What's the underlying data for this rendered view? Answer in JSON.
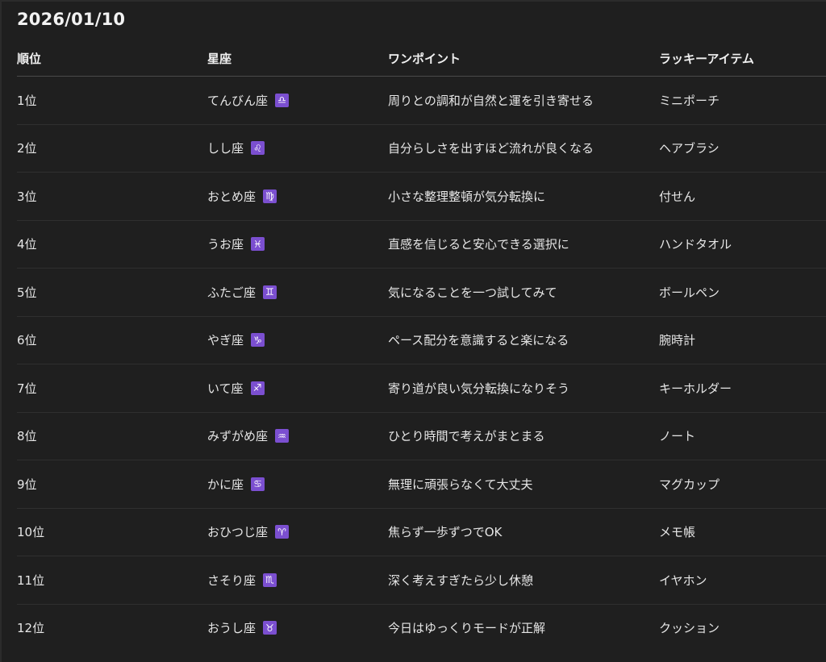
{
  "date": "2026/01/10",
  "table": {
    "headers": {
      "rank": "順位",
      "sign": "星座",
      "tip": "ワンポイント",
      "lucky_item": "ラッキーアイテム"
    },
    "accent_color": "#7b4fd0",
    "rows": [
      {
        "rank": "1位",
        "sign": "てんびん座",
        "symbol": "♎",
        "icon": "libra-icon",
        "tip": "周りとの調和が自然と運を引き寄せる",
        "item": "ミニポーチ"
      },
      {
        "rank": "2位",
        "sign": "しし座",
        "symbol": "♌",
        "icon": "leo-icon",
        "tip": "自分らしさを出すほど流れが良くなる",
        "item": "ヘアブラシ"
      },
      {
        "rank": "3位",
        "sign": "おとめ座",
        "symbol": "♍",
        "icon": "virgo-icon",
        "tip": "小さな整理整頓が気分転換に",
        "item": "付せん"
      },
      {
        "rank": "4位",
        "sign": "うお座",
        "symbol": "♓",
        "icon": "pisces-icon",
        "tip": "直感を信じると安心できる選択に",
        "item": "ハンドタオル"
      },
      {
        "rank": "5位",
        "sign": "ふたご座",
        "symbol": "♊",
        "icon": "gemini-icon",
        "tip": "気になることを一つ試してみて",
        "item": "ボールペン"
      },
      {
        "rank": "6位",
        "sign": "やぎ座",
        "symbol": "♑",
        "icon": "capricorn-icon",
        "tip": "ペース配分を意識すると楽になる",
        "item": "腕時計"
      },
      {
        "rank": "7位",
        "sign": "いて座",
        "symbol": "♐",
        "icon": "sagittarius-icon",
        "tip": "寄り道が良い気分転換になりそう",
        "item": "キーホルダー"
      },
      {
        "rank": "8位",
        "sign": "みずがめ座",
        "symbol": "♒",
        "icon": "aquarius-icon",
        "tip": "ひとり時間で考えがまとまる",
        "item": "ノート"
      },
      {
        "rank": "9位",
        "sign": "かに座",
        "symbol": "♋",
        "icon": "cancer-icon",
        "tip": "無理に頑張らなくて大丈夫",
        "item": "マグカップ"
      },
      {
        "rank": "10位",
        "sign": "おひつじ座",
        "symbol": "♈",
        "icon": "aries-icon",
        "tip": "焦らず一歩ずつでOK",
        "item": "メモ帳"
      },
      {
        "rank": "11位",
        "sign": "さそり座",
        "symbol": "♏",
        "icon": "scorpio-icon",
        "tip": "深く考えすぎたら少し休憩",
        "item": "イヤホン"
      },
      {
        "rank": "12位",
        "sign": "おうし座",
        "symbol": "♉",
        "icon": "taurus-icon",
        "tip": "今日はゆっくりモードが正解",
        "item": "クッション"
      }
    ]
  }
}
